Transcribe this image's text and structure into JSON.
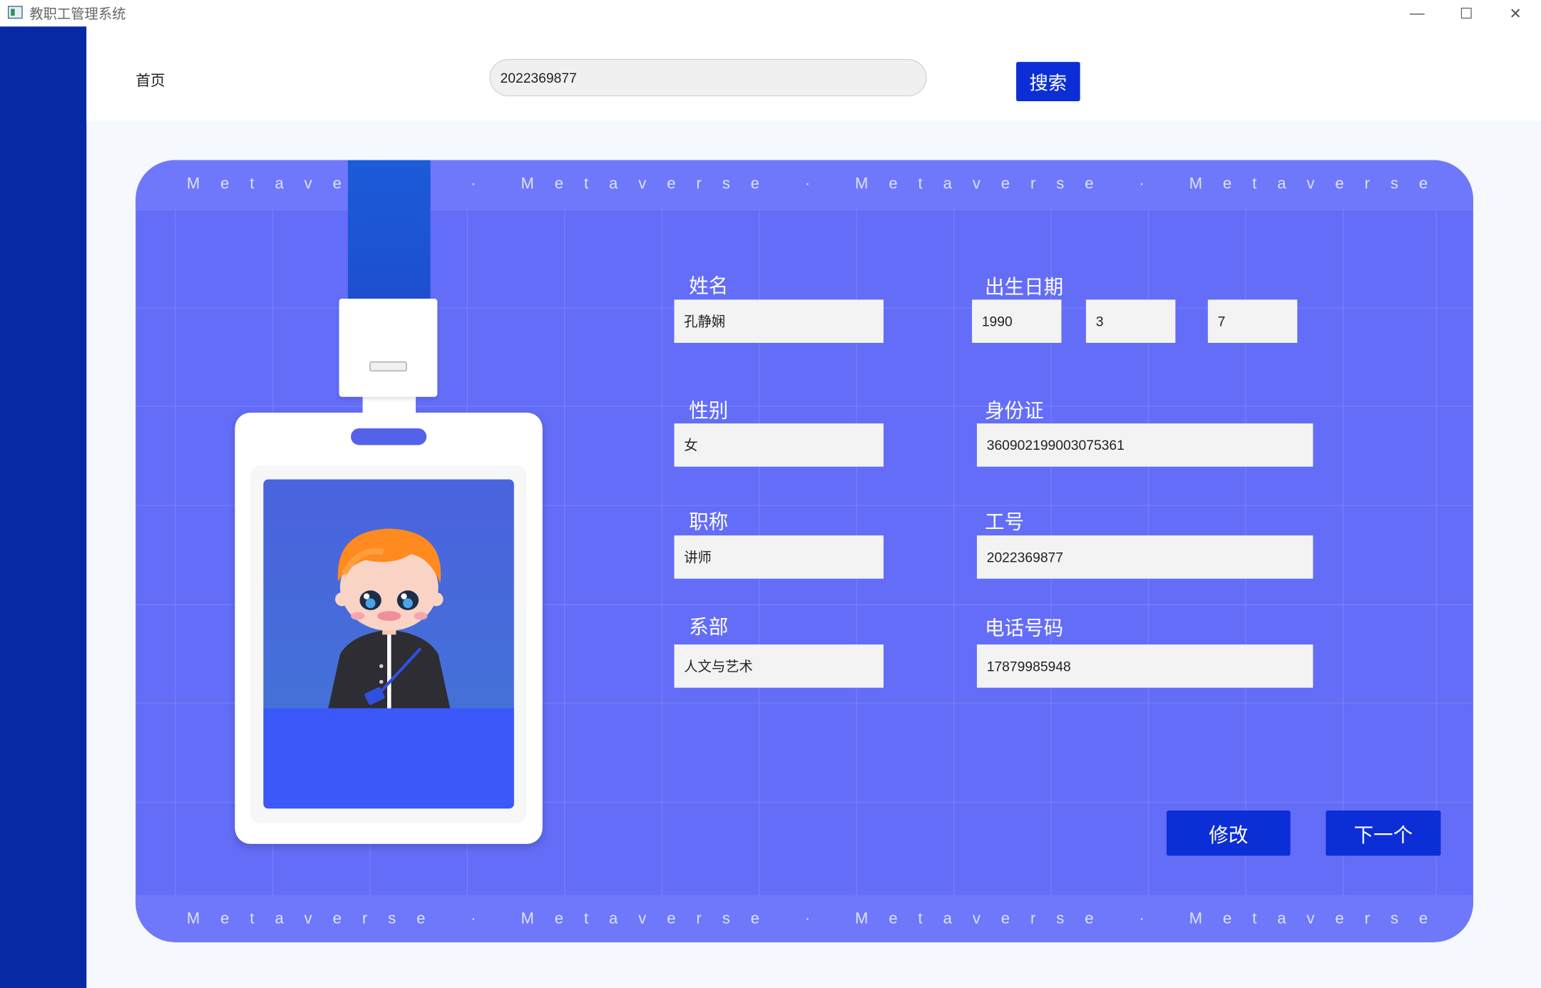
{
  "window": {
    "title": "教职工管理系统",
    "minimize_icon": "—",
    "maximize_icon": "☐",
    "close_icon": "✕"
  },
  "header": {
    "home_label": "首页",
    "search_value": "2022369877",
    "search_button": "搜索"
  },
  "card": {
    "band_word": "Metaverse",
    "band_separator": "·",
    "background_color": "#646df8",
    "lanyard_color": "#1b5cd8"
  },
  "form": {
    "name": {
      "label": "姓名",
      "value": "孔静娴"
    },
    "birth": {
      "label": "出生日期",
      "year": "1990",
      "month": "3",
      "day": "7"
    },
    "gender": {
      "label": "性别",
      "value": "女"
    },
    "id_card": {
      "label": "身份证",
      "value": "360902199003075361"
    },
    "title": {
      "label": "职称",
      "value": "讲师"
    },
    "employee_no": {
      "label": "工号",
      "value": "2022369877"
    },
    "department": {
      "label": "系部",
      "value": "人文与艺术"
    },
    "phone": {
      "label": "电话号码",
      "value": "17879985948"
    }
  },
  "actions": {
    "edit": "修改",
    "next": "下一个"
  },
  "colors": {
    "accent": "#0b2ed6",
    "sidebar": "#062aa5"
  }
}
